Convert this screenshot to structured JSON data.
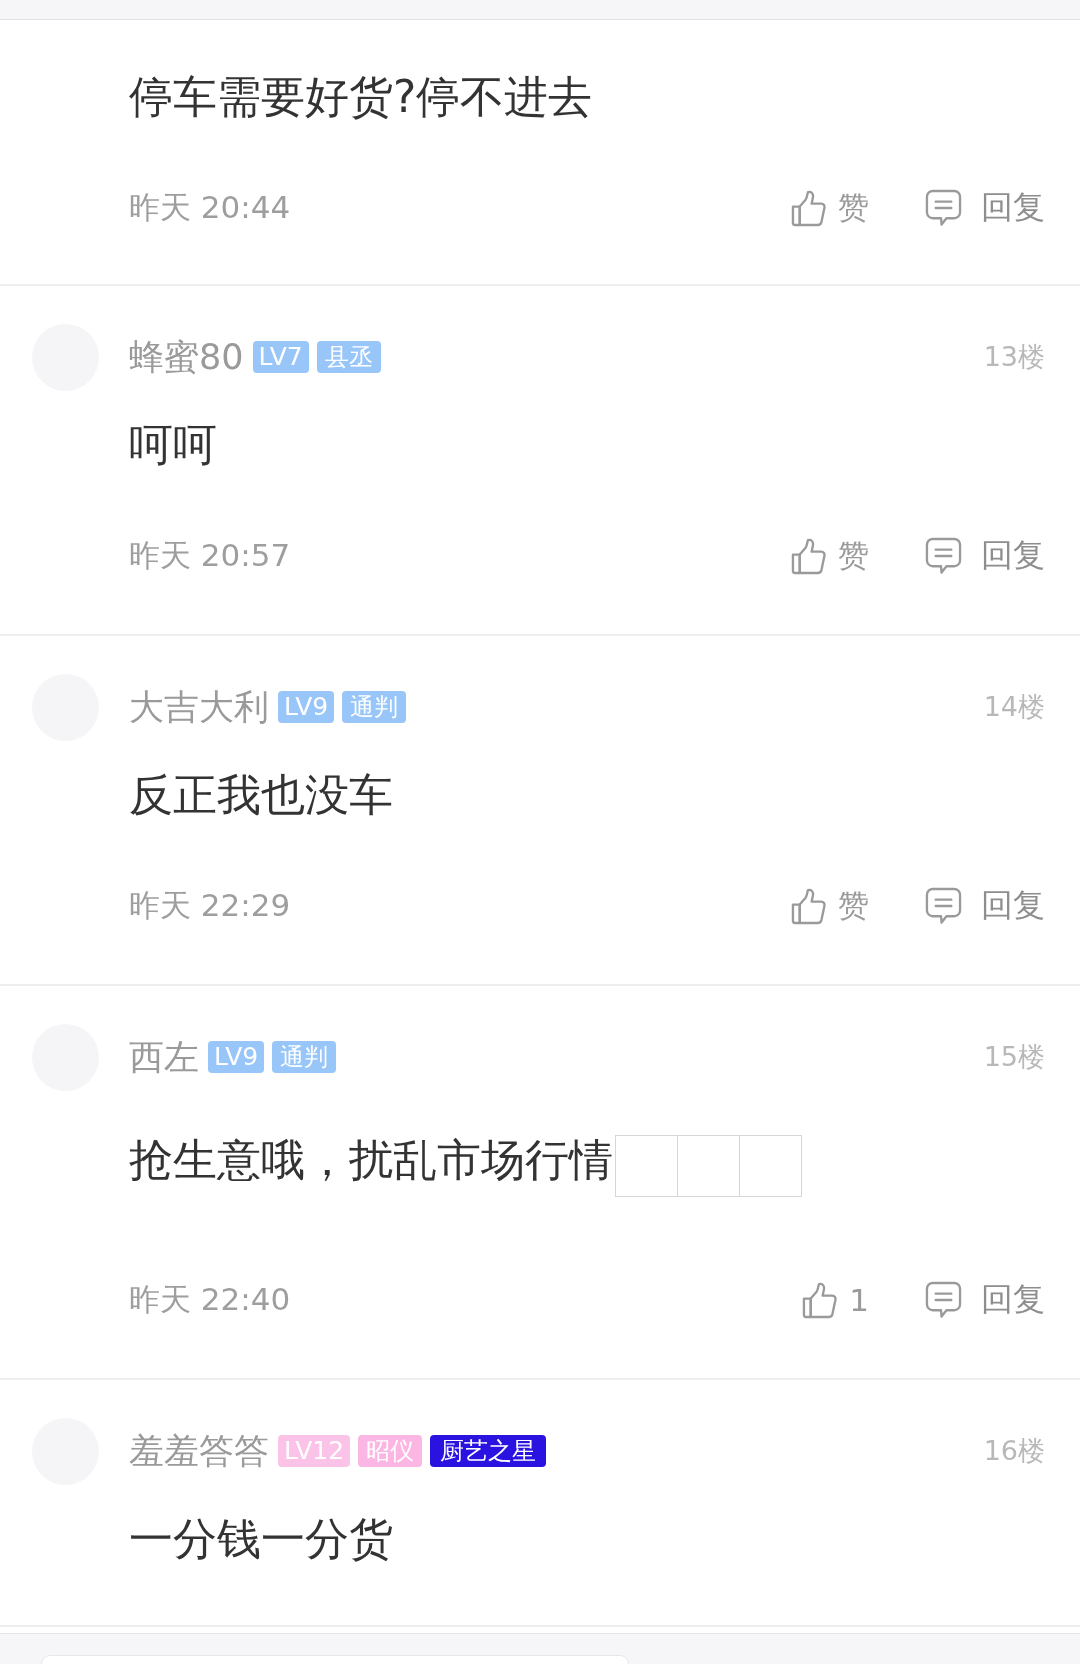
{
  "comments": [
    {
      "text": "停车需要好货?停不进去",
      "time": "昨天 20:44",
      "like": "赞",
      "reply": "回复"
    },
    {
      "user": {
        "name": "蜂蜜80",
        "badges": [
          {
            "kind": "level",
            "label": "LV7",
            "color": "#99c6f9"
          },
          {
            "kind": "rank",
            "label": "县丞",
            "color": "#99c6f9"
          }
        ]
      },
      "floor": "13楼",
      "text": "呵呵",
      "time": "昨天 20:57",
      "like": "赞",
      "reply": "回复"
    },
    {
      "user": {
        "name": "大吉大利",
        "badges": [
          {
            "kind": "level",
            "label": "LV9",
            "color": "#99c6f9"
          },
          {
            "kind": "rank",
            "label": "通判",
            "color": "#99c6f9"
          }
        ]
      },
      "floor": "14楼",
      "text": "反正我也没车",
      "time": "昨天 22:29",
      "like": "赞",
      "reply": "回复"
    },
    {
      "user": {
        "name": "西左",
        "badges": [
          {
            "kind": "level",
            "label": "LV9",
            "color": "#99c6f9"
          },
          {
            "kind": "rank",
            "label": "通判",
            "color": "#99c6f9"
          }
        ]
      },
      "floor": "15楼",
      "text": "抢生意哦，扰乱市场行情",
      "emoji": [
        {
          "kind": "missing"
        },
        {
          "kind": "missing"
        },
        {
          "kind": "missing"
        }
      ],
      "time": "昨天 22:40",
      "like": "1",
      "reply": "回复"
    },
    {
      "user": {
        "name": "羞羞答答",
        "badges": [
          {
            "kind": "level",
            "label": "LV12",
            "color": "#fbc3e7"
          },
          {
            "kind": "rank",
            "label": "昭仪",
            "color": "#fbb6e3"
          },
          {
            "kind": "honor",
            "label": "厨艺之星",
            "color": "#2a12e0"
          }
        ]
      },
      "floor": "16楼",
      "text": "一分钱一分货"
    }
  ]
}
